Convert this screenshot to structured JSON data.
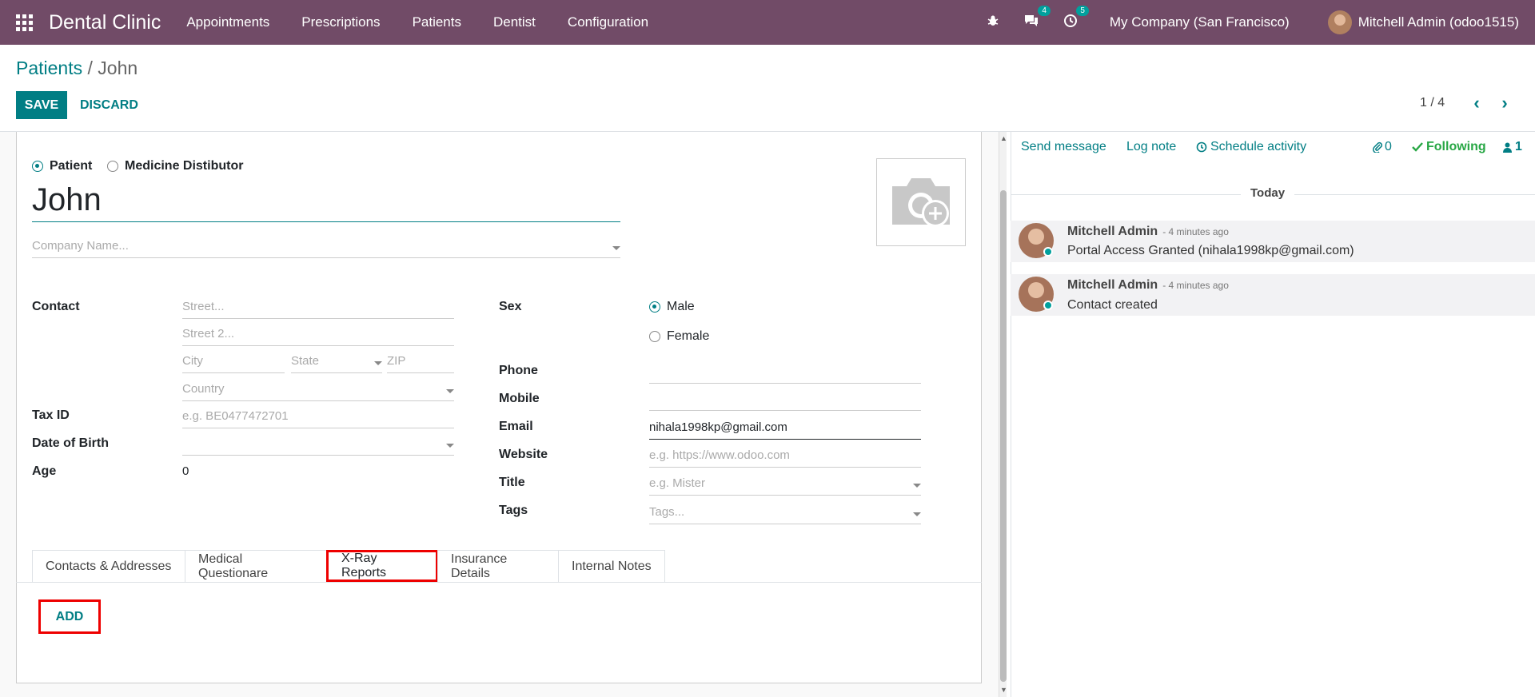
{
  "navbar": {
    "brand": "Dental Clinic",
    "menu": [
      "Appointments",
      "Prescriptions",
      "Patients",
      "Dentist",
      "Configuration"
    ],
    "messages_count": "4",
    "activities_count": "5",
    "company": "My Company (San Francisco)",
    "user": "Mitchell Admin (odoo1515)"
  },
  "breadcrumb": {
    "parent": "Patients",
    "separator": " / ",
    "current": "John"
  },
  "buttons": {
    "save": "SAVE",
    "discard": "DISCARD",
    "add": "ADD"
  },
  "pager": {
    "text": "1 / 4"
  },
  "form": {
    "contact_types": [
      "Patient",
      "Medicine Distibutor"
    ],
    "selected_type": "Patient",
    "name": "John",
    "company_placeholder": "Company Name...",
    "labels": {
      "contact": "Contact",
      "tax_id": "Tax ID",
      "dob": "Date of Birth",
      "age": "Age",
      "sex": "Sex",
      "phone": "Phone",
      "mobile": "Mobile",
      "email": "Email",
      "website": "Website",
      "title": "Title",
      "tags": "Tags"
    },
    "placeholders": {
      "street": "Street...",
      "street2": "Street 2...",
      "city": "City",
      "state": "State",
      "zip": "ZIP",
      "country": "Country",
      "tax_id": "e.g. BE0477472701",
      "website": "e.g. https://www.odoo.com",
      "title": "e.g. Mister",
      "tags": "Tags..."
    },
    "values": {
      "age": "0",
      "email": "nihala1998kp@gmail.com",
      "phone": "",
      "mobile": ""
    },
    "sex_options": [
      "Male",
      "Female"
    ],
    "selected_sex": "Male"
  },
  "tabs": [
    "Contacts & Addresses",
    "Medical Questionare",
    "X-Ray Reports",
    "Insurance Details",
    "Internal Notes"
  ],
  "active_tab": "X-Ray Reports",
  "chatter": {
    "send_message": "Send message",
    "log_note": "Log note",
    "schedule_activity": "Schedule activity",
    "attachments_count": "0",
    "following": "Following",
    "followers_count": "1",
    "date_separator": "Today",
    "messages": [
      {
        "author": "Mitchell Admin",
        "time": "- 4 minutes ago",
        "body": "Portal Access Granted (nihala1998kp@gmail.com)"
      },
      {
        "author": "Mitchell Admin",
        "time": "- 4 minutes ago",
        "body": "Contact created"
      }
    ]
  }
}
